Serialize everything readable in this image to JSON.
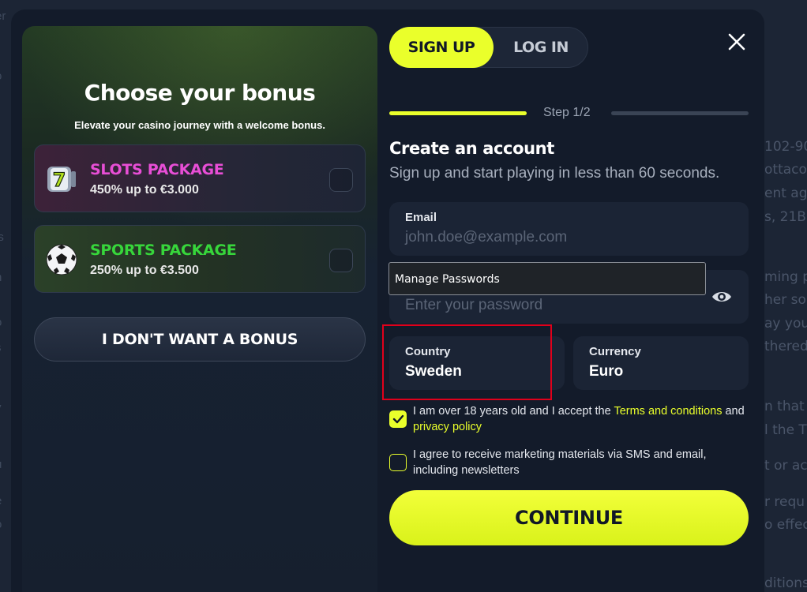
{
  "background": {
    "right_fragments": [
      "102-90",
      "ottaco",
      "ent age",
      "s, 21B,",
      "ming p",
      "her so",
      "ay you",
      "thered",
      "n that v",
      "l the T",
      "t or ac",
      "r requ",
      "o effec",
      "ditions"
    ],
    "left_fragments": [
      "er",
      "o",
      "l",
      "r",
      "ls",
      "i",
      "s",
      "n",
      "o",
      "r",
      "i",
      "y",
      "u",
      "e",
      "o"
    ]
  },
  "bonus": {
    "title": "Choose your bonus",
    "subtitle": "Elevate your casino journey with a welcome bonus.",
    "packages": [
      {
        "name": "SLOTS PACKAGE",
        "desc": "450% up to €3.000",
        "icon": "slot-seven-icon",
        "color": "#e84ed6"
      },
      {
        "name": "SPORTS PACKAGE",
        "desc": "250% up to €3.500",
        "icon": "soccer-ball-icon",
        "color": "#37d63b"
      }
    ],
    "no_bonus_label": "I DON'T WANT A BONUS"
  },
  "auth": {
    "tabs": [
      "SIGN UP",
      "LOG IN"
    ],
    "active_tab": "SIGN UP",
    "step": "Step 1/2",
    "title": "Create an account",
    "subtitle": "Sign up and start playing in less than 60 seconds.",
    "email": {
      "label": "Email",
      "placeholder": "john.doe@example.com"
    },
    "password": {
      "placeholder": "Enter your password"
    },
    "autofill_popup": "Manage Passwords",
    "country": {
      "label": "Country",
      "value": "Sweden"
    },
    "currency": {
      "label": "Currency",
      "value": "Euro"
    },
    "terms": {
      "checked": true,
      "prefix": "I am over 18 years old and I accept the ",
      "link1": "Terms and conditions",
      "middle": " and ",
      "link2": "privacy policy"
    },
    "marketing": {
      "checked": false,
      "text": "I agree to receive marketing materials via SMS and email, including newsletters"
    },
    "continue_label": "CONTINUE"
  },
  "colors": {
    "accent": "#eaff2b",
    "highlight": "#e0001b",
    "background": "#131b2a"
  }
}
